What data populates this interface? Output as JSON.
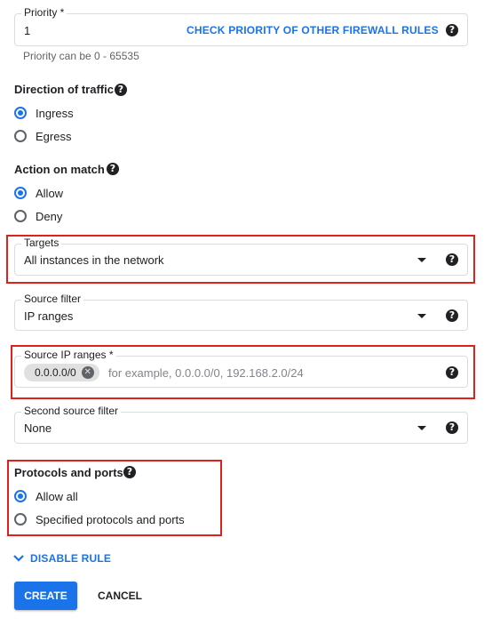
{
  "priority": {
    "label": "Priority *",
    "value": "1",
    "check_link": "CHECK PRIORITY OF OTHER FIREWALL RULES",
    "hint": "Priority can be 0 - 65535"
  },
  "direction": {
    "title": "Direction of traffic",
    "options": [
      {
        "label": "Ingress",
        "selected": true
      },
      {
        "label": "Egress",
        "selected": false
      }
    ]
  },
  "action": {
    "title": "Action on match",
    "options": [
      {
        "label": "Allow",
        "selected": true
      },
      {
        "label": "Deny",
        "selected": false
      }
    ]
  },
  "targets": {
    "label": "Targets",
    "value": "All instances in the network"
  },
  "source_filter": {
    "label": "Source filter",
    "value": "IP ranges"
  },
  "source_ip_ranges": {
    "label": "Source IP ranges *",
    "chip": "0.0.0.0/0",
    "placeholder": "for example, 0.0.0.0/0, 192.168.2.0/24"
  },
  "second_source_filter": {
    "label": "Second source filter",
    "value": "None"
  },
  "protocols": {
    "title": "Protocols and ports",
    "options": [
      {
        "label": "Allow all",
        "selected": true
      },
      {
        "label": "Specified protocols and ports",
        "selected": false
      }
    ]
  },
  "disable_rule": "DISABLE RULE",
  "buttons": {
    "create": "CREATE",
    "cancel": "CANCEL"
  },
  "colors": {
    "accent": "#1a73e8",
    "highlight": "#e0201b",
    "border": "#dadce0"
  },
  "icons": {
    "help": "help-circle-icon",
    "dropdown": "caret-down-icon",
    "chip_remove": "close-circle-icon",
    "expand": "chevron-down-icon"
  }
}
